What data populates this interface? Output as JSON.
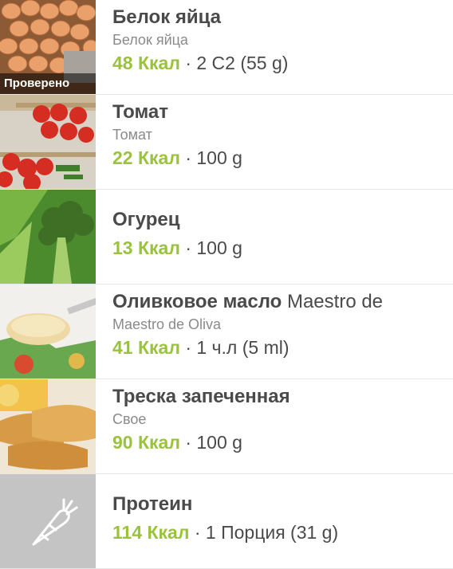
{
  "colors": {
    "calorie": "#9ac33c",
    "title": "#4a4a4a",
    "subtitle": "#8a8a8a",
    "divider": "#e6e6e6"
  },
  "items": [
    {
      "title": "Белок яйца",
      "brand": "",
      "subtitle": "Белок яйца",
      "calories": "48 Ккал",
      "portion": " · 2 С2 (55 g)",
      "badge": "Проверено",
      "image": "eggs-photo"
    },
    {
      "title": "Томат",
      "brand": "",
      "subtitle": "Томат",
      "calories": "22 Ккал",
      "portion": " · 100 g",
      "badge": "",
      "image": "tomatoes-photo"
    },
    {
      "title": "Огурец",
      "brand": "",
      "subtitle": "",
      "calories": "13 Ккал",
      "portion": " · 100 g",
      "badge": "",
      "image": "broccoli-photo"
    },
    {
      "title": "Оливковое масло",
      "brand": " Maestro de",
      "subtitle": "Maestro de Oliva",
      "calories": "41 Ккал",
      "portion": " · 1 ч.л (5 ml)",
      "badge": "",
      "image": "mayonnaise-spoon-photo"
    },
    {
      "title": "Треска запеченная",
      "brand": "",
      "subtitle": "Свое",
      "calories": "90 Ккал",
      "portion": " · 100 g",
      "badge": "",
      "image": "fried-fish-photo"
    },
    {
      "title": "Протеин",
      "brand": "",
      "subtitle": "",
      "calories": "114 Ккал",
      "portion": " · 1 Порция  (31 g)",
      "badge": "",
      "image": "carrot-icon"
    }
  ]
}
